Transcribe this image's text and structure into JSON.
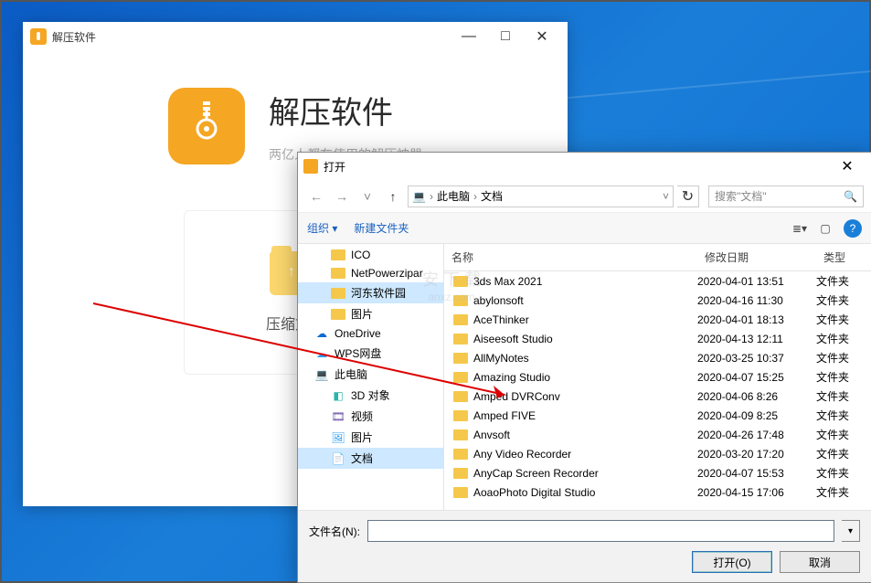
{
  "main_window": {
    "title": "解压软件",
    "heading": "解压软件",
    "subtitle": "两亿人都在使用的解压神器",
    "card_compress_label": "压缩文件"
  },
  "win_controls": {
    "min": "—",
    "max": "□",
    "close": "✕"
  },
  "dialog": {
    "title": "打开",
    "breadcrumb": {
      "root_icon": "💻",
      "seg1": "此电脑",
      "seg2": "文档"
    },
    "search_placeholder": "搜索\"文档\"",
    "toolbar": {
      "organize": "组织 ▾",
      "newfolder": "新建文件夹"
    },
    "columns": {
      "name": "名称",
      "date": "修改日期",
      "type": "类型"
    },
    "tree": [
      {
        "label": "ICO",
        "kind": "folder",
        "indent": 2
      },
      {
        "label": "NetPowerzipar",
        "kind": "folder",
        "indent": 2
      },
      {
        "label": "河东软件园",
        "kind": "folder",
        "indent": 2,
        "selected": true
      },
      {
        "label": "图片",
        "kind": "folder",
        "indent": 2
      },
      {
        "label": "OneDrive",
        "kind": "onedrive",
        "indent": 1
      },
      {
        "label": "WPS网盘",
        "kind": "wps",
        "indent": 1
      },
      {
        "label": "此电脑",
        "kind": "pc",
        "indent": 1
      },
      {
        "label": "3D 对象",
        "kind": "3d",
        "indent": 2
      },
      {
        "label": "视频",
        "kind": "video",
        "indent": 2
      },
      {
        "label": "图片",
        "kind": "pic",
        "indent": 2
      },
      {
        "label": "文档",
        "kind": "doc",
        "indent": 2,
        "selected": true
      }
    ],
    "files": [
      {
        "name": "3ds Max 2021",
        "date": "2020-04-01 13:51",
        "type": "文件夹"
      },
      {
        "name": "abylonsoft",
        "date": "2020-04-16 11:30",
        "type": "文件夹"
      },
      {
        "name": "AceThinker",
        "date": "2020-04-01 18:13",
        "type": "文件夹"
      },
      {
        "name": "Aiseesoft Studio",
        "date": "2020-04-13 12:11",
        "type": "文件夹"
      },
      {
        "name": "AllMyNotes",
        "date": "2020-03-25 10:37",
        "type": "文件夹"
      },
      {
        "name": "Amazing Studio",
        "date": "2020-04-07 15:25",
        "type": "文件夹"
      },
      {
        "name": "Amped DVRConv",
        "date": "2020-04-06 8:26",
        "type": "文件夹"
      },
      {
        "name": "Amped FIVE",
        "date": "2020-04-09 8:25",
        "type": "文件夹"
      },
      {
        "name": "Anvsoft",
        "date": "2020-04-26 17:48",
        "type": "文件夹"
      },
      {
        "name": "Any Video Recorder",
        "date": "2020-03-20 17:20",
        "type": "文件夹"
      },
      {
        "name": "AnyCap Screen Recorder",
        "date": "2020-04-07 15:53",
        "type": "文件夹"
      },
      {
        "name": "AoaoPhoto Digital Studio",
        "date": "2020-04-15 17:06",
        "type": "文件夹"
      }
    ],
    "filename_label": "文件名(N):",
    "open_btn": "打开(O)",
    "cancel_btn": "取消"
  },
  "watermark": {
    "line1": "安 下 载",
    "line2": "anxz.com"
  }
}
